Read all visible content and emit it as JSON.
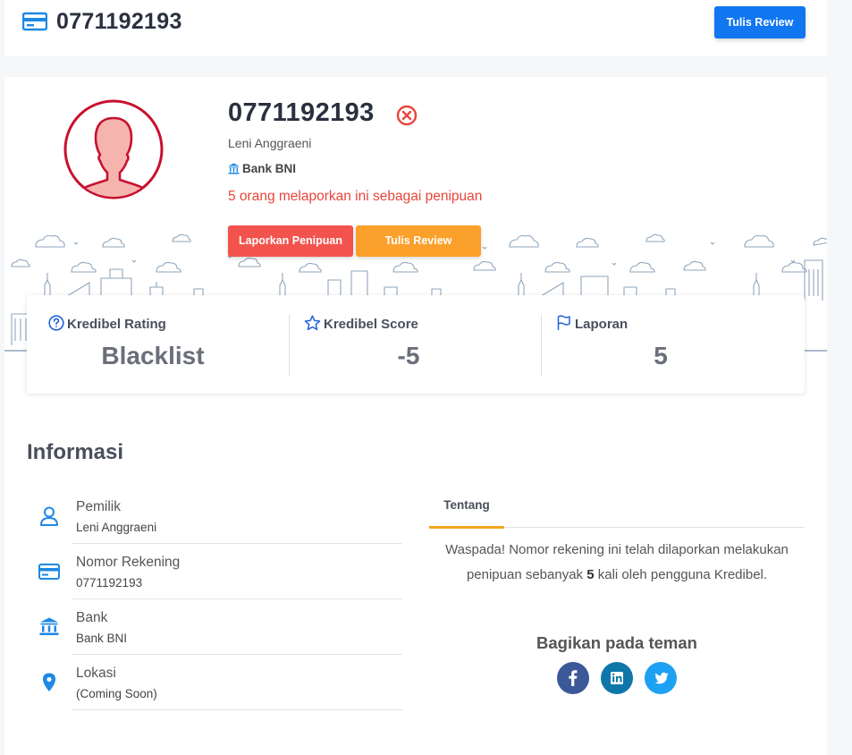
{
  "header": {
    "title": "0771192193",
    "review_button": "Tulis Review",
    "card_icon": "credit-card-icon"
  },
  "profile": {
    "account_number": "0771192193",
    "status_icon": "x-circle-icon",
    "owner": "Leni Anggraeni",
    "bank": "Bank BNI",
    "warning": "5 orang melaporkan ini sebagai penipuan",
    "report_button": "Laporkan Penipuan",
    "review_button": "Tulis Review"
  },
  "stats": [
    {
      "label": "Kredibel Rating",
      "value": "Blacklist",
      "icon": "question-circle-icon"
    },
    {
      "label": "Kredibel Score",
      "value": "-5",
      "icon": "star-icon"
    },
    {
      "label": "Laporan",
      "value": "5",
      "icon": "flag-icon"
    }
  ],
  "info": {
    "title": "Informasi",
    "rows": [
      {
        "label": "Pemilik",
        "value": "Leni Anggraeni",
        "icon": "user-icon"
      },
      {
        "label": "Nomor Rekening",
        "value": "0771192193",
        "icon": "credit-card-icon"
      },
      {
        "label": "Bank",
        "value": "Bank BNI",
        "icon": "bank-icon"
      },
      {
        "label": "Lokasi",
        "value": "(Coming Soon)",
        "icon": "location-pin-icon"
      }
    ]
  },
  "about": {
    "tab": "Tentang",
    "text_pre": "Waspada! Nomor rekening ini telah dilaporkan melakukan penipuan sebanyak",
    "count": "5",
    "text_post": "kali oleh pengguna Kredibel."
  },
  "share": {
    "title": "Bagikan pada teman",
    "networks": [
      {
        "name": "facebook-icon",
        "color": "#3b5998"
      },
      {
        "name": "linkedin-icon",
        "color": "#0e76a8"
      },
      {
        "name": "twitter-icon",
        "color": "#1da1f2"
      }
    ]
  },
  "colors": {
    "primary": "#1177f0",
    "danger": "#f2534d",
    "warning": "#fba02a",
    "accent_icon": "#1e88e5"
  }
}
